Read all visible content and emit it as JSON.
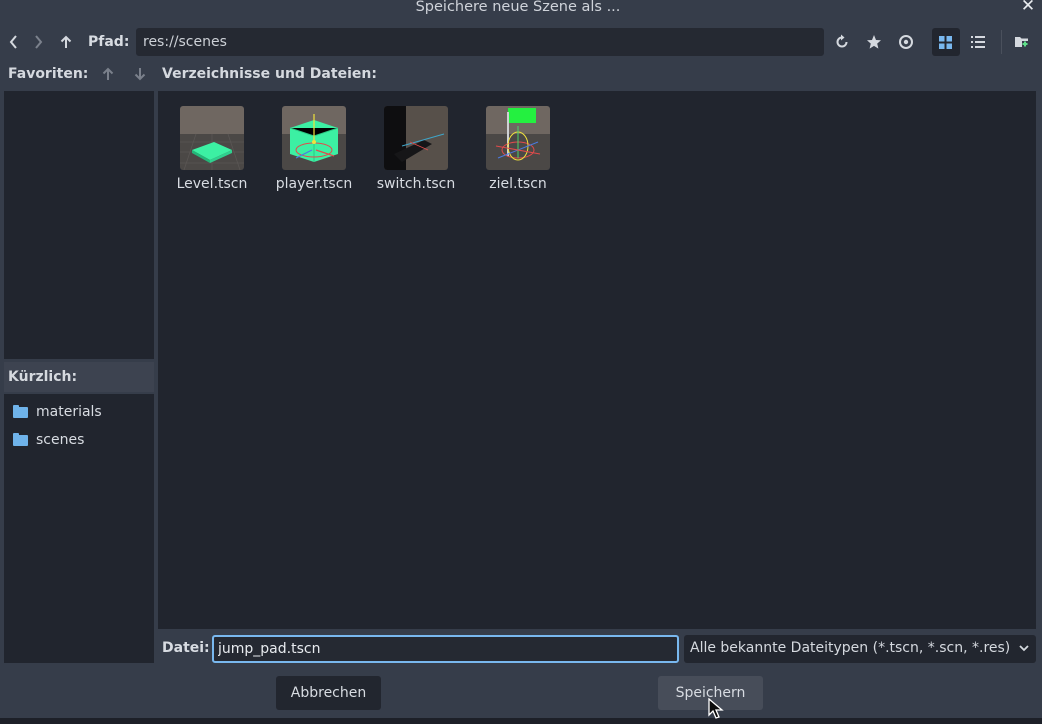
{
  "dialog": {
    "title": "Speichere neue Szene als ..."
  },
  "toolbar": {
    "path_label": "Pfad:",
    "path_value": "res://scenes",
    "icons": [
      "back-icon",
      "forward-icon",
      "up-icon",
      "refresh-icon",
      "favorite-star-icon",
      "show-hidden-eye-icon",
      "grid-view-icon",
      "list-view-icon",
      "new-folder-icon"
    ]
  },
  "favorites": {
    "label": "Favoriten:"
  },
  "recent": {
    "label": "Kürzlich:",
    "items": [
      {
        "label": "materials"
      },
      {
        "label": "scenes"
      }
    ]
  },
  "files": {
    "label": "Verzeichnisse und Dateien:",
    "items": [
      {
        "name": "Level.tscn"
      },
      {
        "name": "player.tscn"
      },
      {
        "name": "switch.tscn"
      },
      {
        "name": "ziel.tscn"
      }
    ]
  },
  "footer": {
    "file_label": "Datei:",
    "file_value": "jump_pad.tscn",
    "filter_value": "Alle bekannte Dateitypen (*.tscn, *.scn, *.res)",
    "cancel_label": "Abbrechen",
    "save_label": "Speichern"
  },
  "colors": {
    "accent": "#79b8ef",
    "folder": "#6fb3ea",
    "panel": "#21252e",
    "background": "#363d4a"
  }
}
